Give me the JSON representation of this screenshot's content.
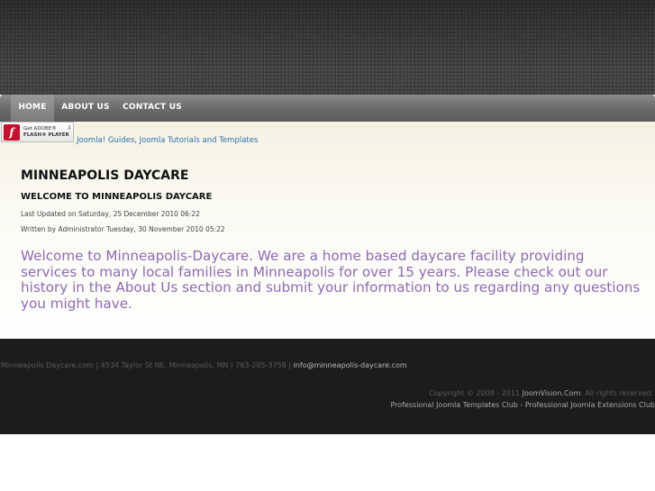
{
  "nav": {
    "items": [
      {
        "label": "HOME"
      },
      {
        "label": "ABOUT US"
      },
      {
        "label": "CONTACT US"
      }
    ]
  },
  "flash_badge": {
    "logo_letter": "f",
    "line1": "Get ADOBE®",
    "line2": "FLASH® PLAYER",
    "arrow": "⇩"
  },
  "joomla_link": "Joomla! Guides, Joomla Tutorials and Templates",
  "site_title": "MINNEAPOLIS DAYCARE",
  "article": {
    "title": "WELCOME TO MINNEAPOLIS DAYCARE",
    "last_updated": "Last Updated on Saturday, 25 December 2010 06:22",
    "written_by": "Written by Administrator Tuesday, 30 November 2010 05:22",
    "body": "Welcome to Minneapolis-Daycare. We are a home based daycare facility providing services to many local families in Minneapolis for over 15 years. Please check out our history in the About Us section and submit your information to us regarding any questions you might have."
  },
  "footer": {
    "address": "Minneapolis Daycare.com | 4534 Taylor St NE, Minneapolis, MN | 763-205-3758 | ",
    "email": "info@minneapolis-daycare.com",
    "copyright_prefix": "Copyright © 2008 - 2011 ",
    "copyright_brand": "JoomVision.Com",
    "copyright_suffix": ". All rights reserved.",
    "pro_link_1": "Professional Joomla Templates Club",
    "separator": " - ",
    "pro_link_2": "Professional Joomla Extensions Club"
  }
}
